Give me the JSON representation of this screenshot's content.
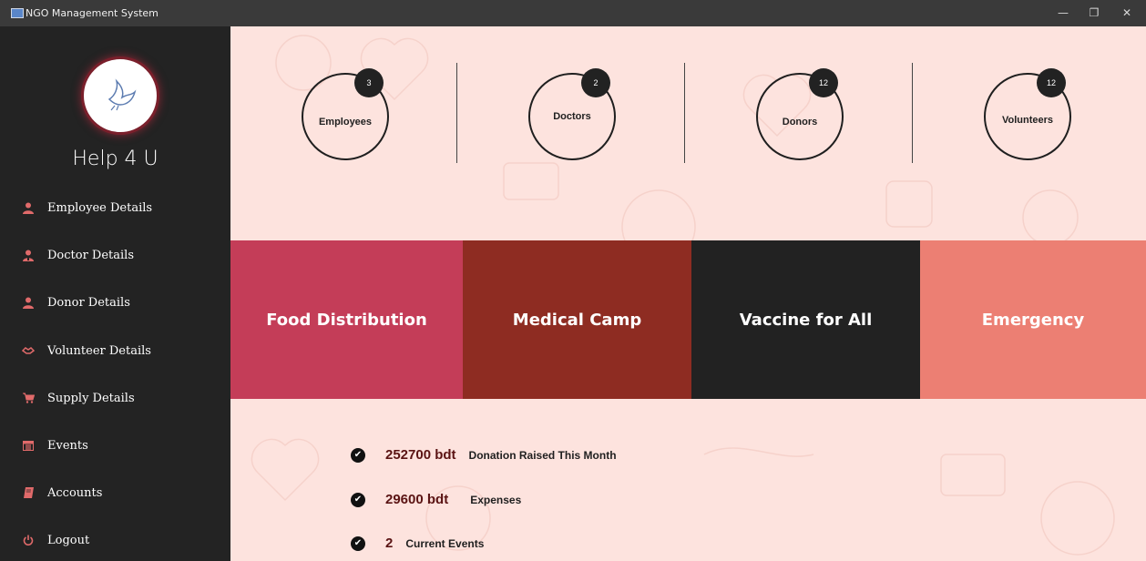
{
  "window": {
    "title": "NGO Management System",
    "minimize": "—",
    "maximize": "❐",
    "close": "✕"
  },
  "sidebar": {
    "brand": "Help 4 U",
    "logo_icon": "dove-icon",
    "items": [
      {
        "label": "Employee Details",
        "icon": "person-icon"
      },
      {
        "label": "Doctor Details",
        "icon": "doctor-icon"
      },
      {
        "label": "Donor Details",
        "icon": "person-icon"
      },
      {
        "label": "Volunteer Details",
        "icon": "handshake-icon"
      },
      {
        "label": "Supply Details",
        "icon": "cart-icon"
      },
      {
        "label": "Events",
        "icon": "calendar-icon"
      },
      {
        "label": "Accounts",
        "icon": "book-icon"
      },
      {
        "label": "Logout",
        "icon": "power-icon"
      }
    ]
  },
  "stats": [
    {
      "label": "Employees",
      "count": "3"
    },
    {
      "label": "Doctors",
      "count": "2"
    },
    {
      "label": "Donors",
      "count": "12"
    },
    {
      "label": "Volunteers",
      "count": "12"
    }
  ],
  "tiles": [
    {
      "label": "Food Distribution",
      "color": "#c43d58"
    },
    {
      "label": "Medical Camp",
      "color": "#8e2c22"
    },
    {
      "label": "Vaccine for All",
      "color": "#222222"
    },
    {
      "label": "Emergency",
      "color": "#ec7f73"
    }
  ],
  "summary": [
    {
      "amount": "252700 bdt",
      "desc": "Donation Raised This Month"
    },
    {
      "amount": "29600 bdt",
      "desc": "Expenses"
    },
    {
      "amount": "2",
      "desc": "Current Events"
    }
  ],
  "colors": {
    "sidebar_bg": "#232323",
    "main_bg": "#fde3de",
    "accent": "#e06a6a"
  }
}
